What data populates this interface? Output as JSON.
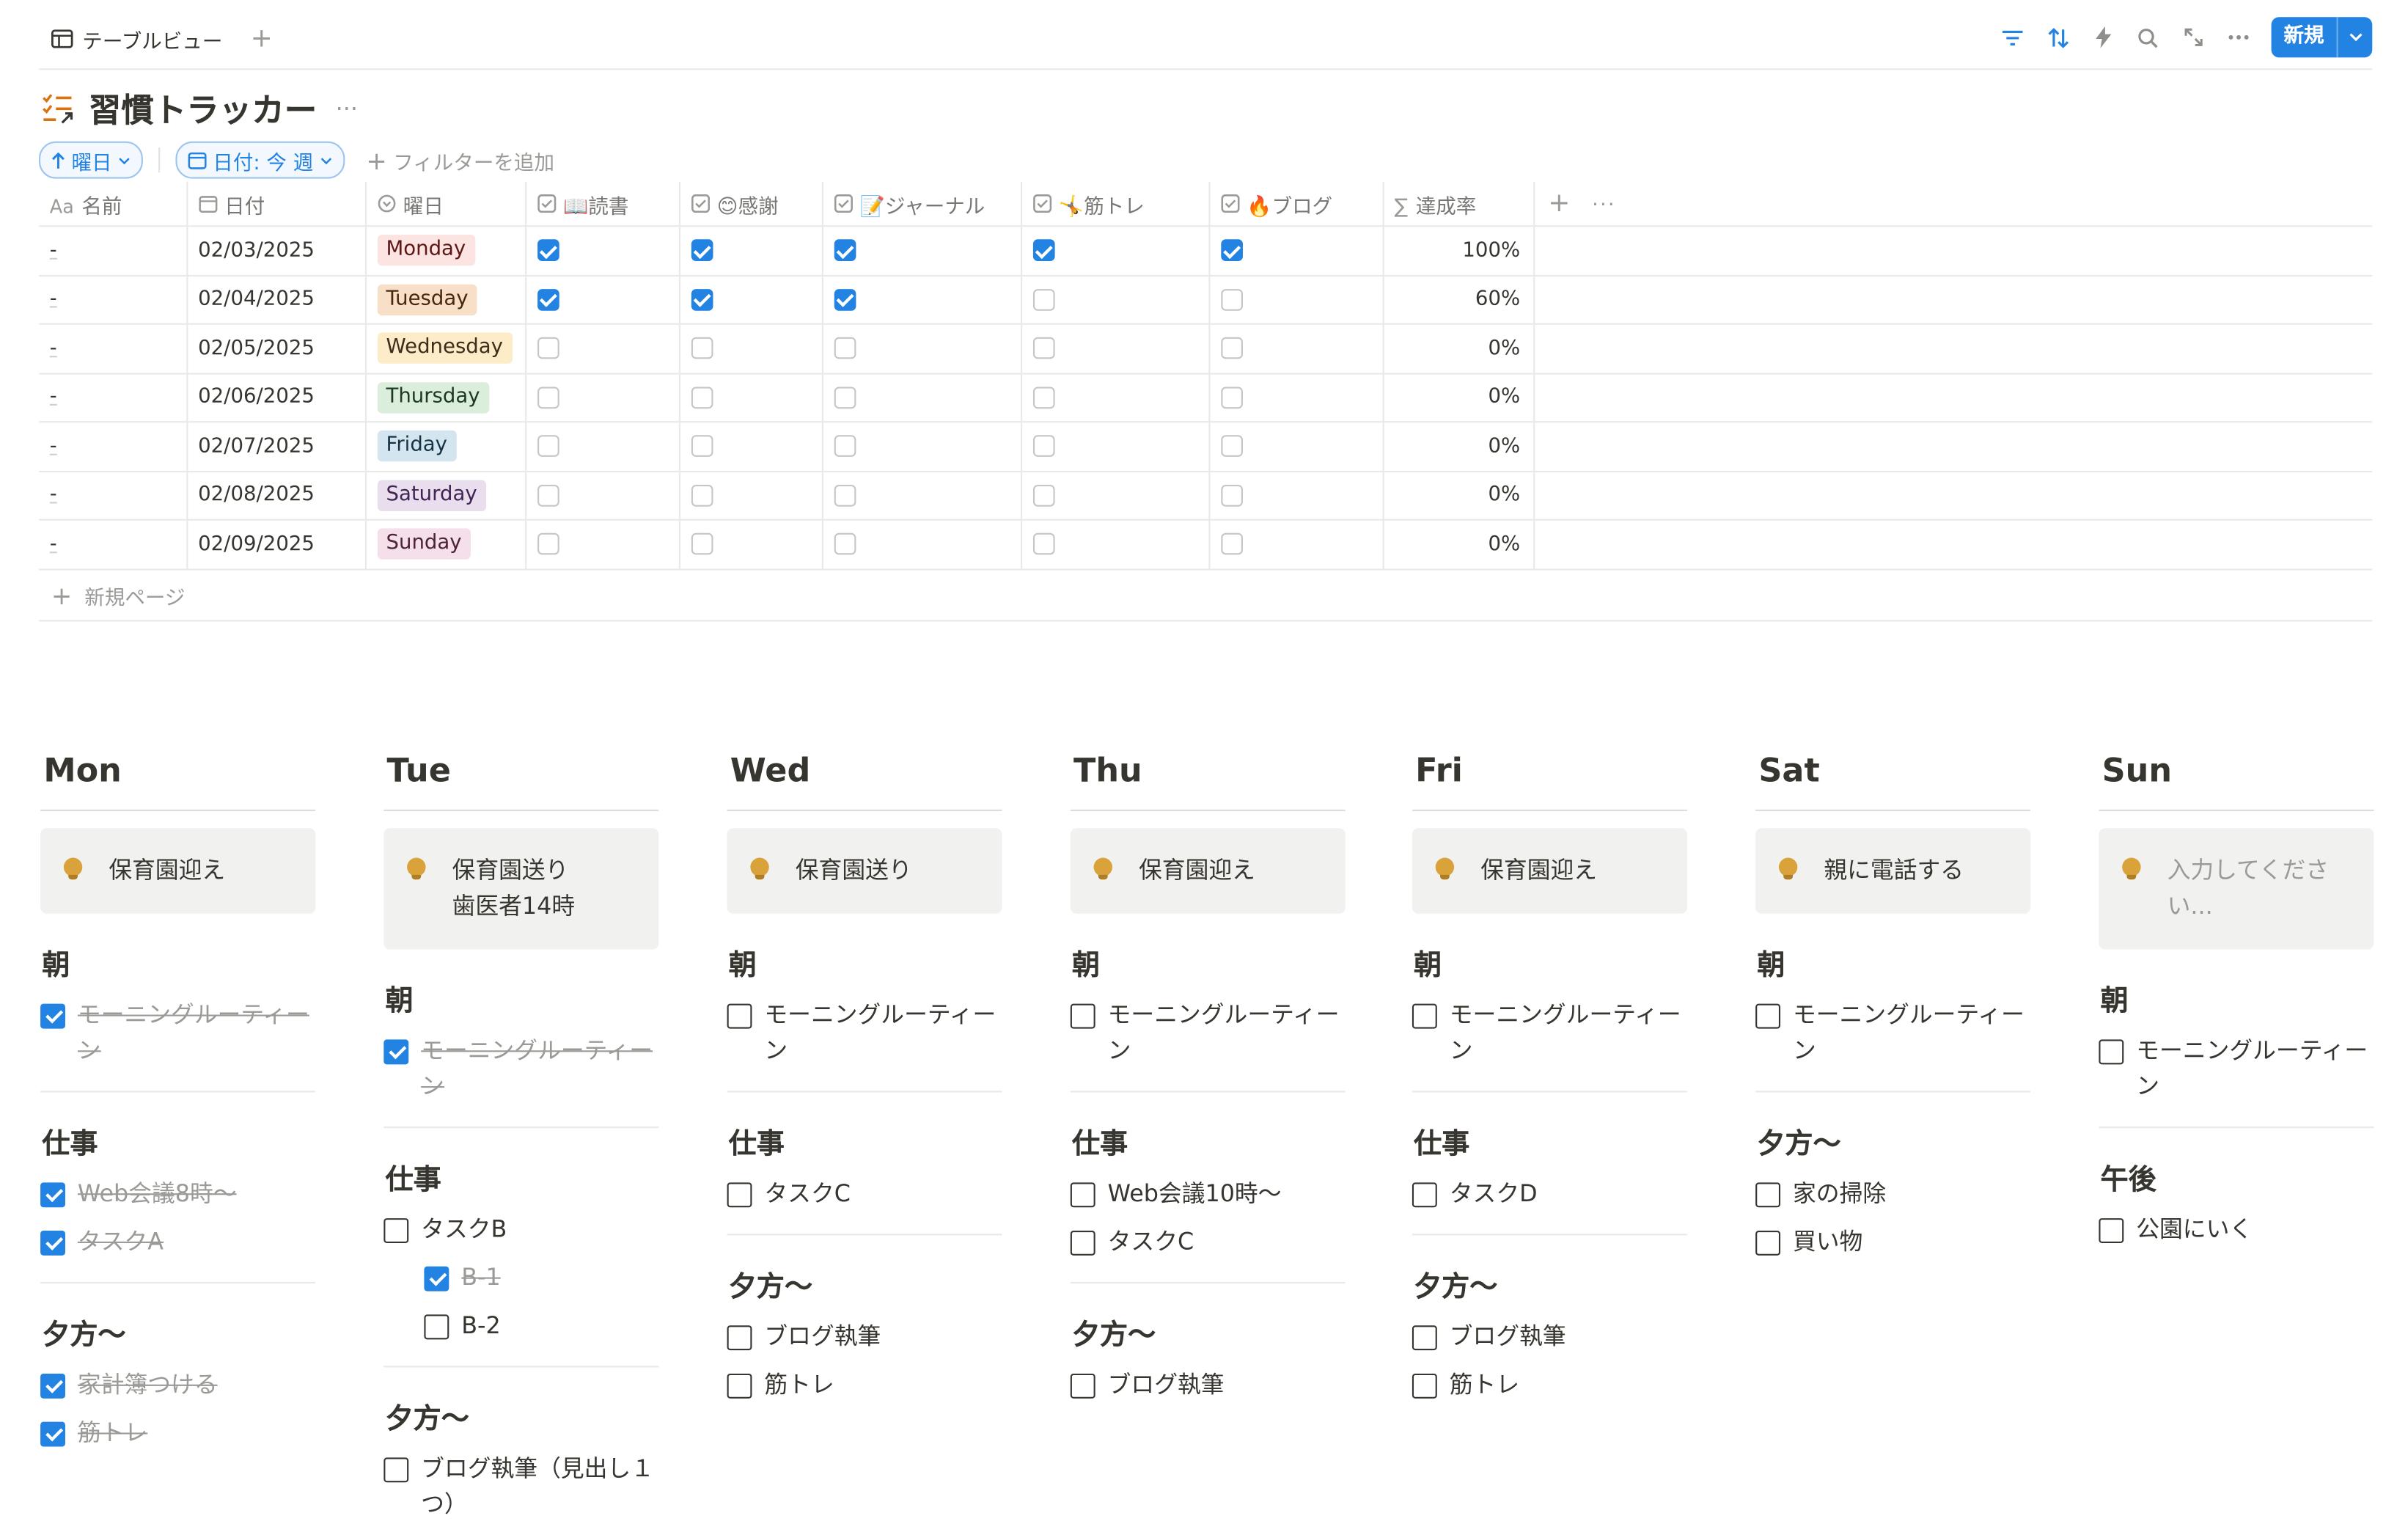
{
  "topbar": {
    "view_label": "テーブルビュー",
    "add_view": "+",
    "new_button": "新規"
  },
  "page": {
    "title": "習慣トラッカー",
    "more": "···"
  },
  "filters": {
    "sort_label": "曜日",
    "date_filter_label": "日付: 今 週",
    "add_filter": "フィルターを追加"
  },
  "table": {
    "columns": [
      "名前",
      "日付",
      "曜日",
      "📖読書",
      "😊感謝",
      "📝ジャーナル",
      "🤸筋トレ",
      "🔥ブログ",
      "達成率"
    ],
    "column_icons": [
      "Aa",
      "calendar-icon",
      "select-icon",
      "checkbox-icon",
      "checkbox-icon",
      "checkbox-icon",
      "checkbox-icon",
      "checkbox-icon",
      "sigma-icon"
    ],
    "rows": [
      {
        "name": "-",
        "date": "02/03/2025",
        "day": "Monday",
        "day_bg": "#fbe4e1",
        "day_fg": "#5d1715",
        "checks": [
          true,
          true,
          true,
          true,
          true
        ],
        "rate": "100%"
      },
      {
        "name": "-",
        "date": "02/04/2025",
        "day": "Tuesday",
        "day_bg": "#f8dfc8",
        "day_fg": "#49290e",
        "checks": [
          true,
          true,
          true,
          false,
          false
        ],
        "rate": "60%"
      },
      {
        "name": "-",
        "date": "02/05/2025",
        "day": "Wednesday",
        "day_bg": "#fdecc8",
        "day_fg": "#402c1b",
        "checks": [
          false,
          false,
          false,
          false,
          false
        ],
        "rate": "0%"
      },
      {
        "name": "-",
        "date": "02/06/2025",
        "day": "Thursday",
        "day_bg": "#dbeddb",
        "day_fg": "#1c3829",
        "checks": [
          false,
          false,
          false,
          false,
          false
        ],
        "rate": "0%"
      },
      {
        "name": "-",
        "date": "02/07/2025",
        "day": "Friday",
        "day_bg": "#d3e5ef",
        "day_fg": "#183347",
        "checks": [
          false,
          false,
          false,
          false,
          false
        ],
        "rate": "0%"
      },
      {
        "name": "-",
        "date": "02/08/2025",
        "day": "Saturday",
        "day_bg": "#e8deee",
        "day_fg": "#412454",
        "checks": [
          false,
          false,
          false,
          false,
          false
        ],
        "rate": "0%"
      },
      {
        "name": "-",
        "date": "02/09/2025",
        "day": "Sunday",
        "day_bg": "#f4dfeb",
        "day_fg": "#4c2337",
        "checks": [
          false,
          false,
          false,
          false,
          false
        ],
        "rate": "0%"
      }
    ],
    "new_page": "新規ページ"
  },
  "days": [
    {
      "name": "Mon",
      "callout": "保育園迎え",
      "placeholder": false,
      "sections": [
        {
          "title": "朝",
          "items": [
            {
              "text": "モーニングルーティーン",
              "done": true,
              "indent": false
            }
          ]
        },
        {
          "title": "仕事",
          "items": [
            {
              "text": "Web会議8時〜",
              "done": true,
              "indent": false
            },
            {
              "text": "タスクA",
              "done": true,
              "indent": false
            }
          ]
        },
        {
          "title": "夕方〜",
          "items": [
            {
              "text": "家計簿つける",
              "done": true,
              "indent": false
            },
            {
              "text": "筋トレ",
              "done": true,
              "indent": false
            }
          ]
        }
      ]
    },
    {
      "name": "Tue",
      "callout": "保育園送り\n歯医者14時",
      "placeholder": false,
      "sections": [
        {
          "title": "朝",
          "items": [
            {
              "text": "モーニングルーティーン",
              "done": true,
              "indent": false
            }
          ]
        },
        {
          "title": "仕事",
          "items": [
            {
              "text": "タスクB",
              "done": false,
              "indent": false
            },
            {
              "text": "B-1",
              "done": true,
              "indent": true
            },
            {
              "text": "B-2",
              "done": false,
              "indent": true
            }
          ]
        },
        {
          "title": "夕方〜",
          "items": [
            {
              "text": "ブログ執筆（見出し１つ）",
              "done": false,
              "indent": false
            }
          ]
        }
      ]
    },
    {
      "name": "Wed",
      "callout": "保育園送り",
      "placeholder": false,
      "sections": [
        {
          "title": "朝",
          "items": [
            {
              "text": "モーニングルーティーン",
              "done": false,
              "indent": false
            }
          ]
        },
        {
          "title": "仕事",
          "items": [
            {
              "text": "タスクC",
              "done": false,
              "indent": false
            }
          ]
        },
        {
          "title": "夕方〜",
          "items": [
            {
              "text": "ブログ執筆",
              "done": false,
              "indent": false
            },
            {
              "text": "筋トレ",
              "done": false,
              "indent": false
            }
          ]
        }
      ]
    },
    {
      "name": "Thu",
      "callout": "保育園迎え",
      "placeholder": false,
      "sections": [
        {
          "title": "朝",
          "items": [
            {
              "text": "モーニングルーティーン",
              "done": false,
              "indent": false
            }
          ]
        },
        {
          "title": "仕事",
          "items": [
            {
              "text": "Web会議10時〜",
              "done": false,
              "indent": false
            },
            {
              "text": "タスクC",
              "done": false,
              "indent": false
            }
          ]
        },
        {
          "title": "夕方〜",
          "items": [
            {
              "text": "ブログ執筆",
              "done": false,
              "indent": false
            }
          ]
        }
      ]
    },
    {
      "name": "Fri",
      "callout": "保育園迎え",
      "placeholder": false,
      "sections": [
        {
          "title": "朝",
          "items": [
            {
              "text": "モーニングルーティーン",
              "done": false,
              "indent": false
            }
          ]
        },
        {
          "title": "仕事",
          "items": [
            {
              "text": "タスクD",
              "done": false,
              "indent": false
            }
          ]
        },
        {
          "title": "夕方〜",
          "items": [
            {
              "text": "ブログ執筆",
              "done": false,
              "indent": false
            },
            {
              "text": "筋トレ",
              "done": false,
              "indent": false
            }
          ]
        }
      ]
    },
    {
      "name": "Sat",
      "callout": "親に電話する",
      "placeholder": false,
      "sections": [
        {
          "title": "朝",
          "items": [
            {
              "text": "モーニングルーティーン",
              "done": false,
              "indent": false
            }
          ]
        },
        {
          "title": "夕方〜",
          "items": [
            {
              "text": "家の掃除",
              "done": false,
              "indent": false
            },
            {
              "text": "買い物",
              "done": false,
              "indent": false
            }
          ]
        }
      ]
    },
    {
      "name": "Sun",
      "callout": "入力してください...",
      "placeholder": true,
      "sections": [
        {
          "title": "朝",
          "items": [
            {
              "text": "モーニングルーティーン",
              "done": false,
              "indent": false
            }
          ]
        },
        {
          "title": "午後",
          "items": [
            {
              "text": "公園にいく",
              "done": false,
              "indent": false
            }
          ]
        }
      ]
    }
  ]
}
